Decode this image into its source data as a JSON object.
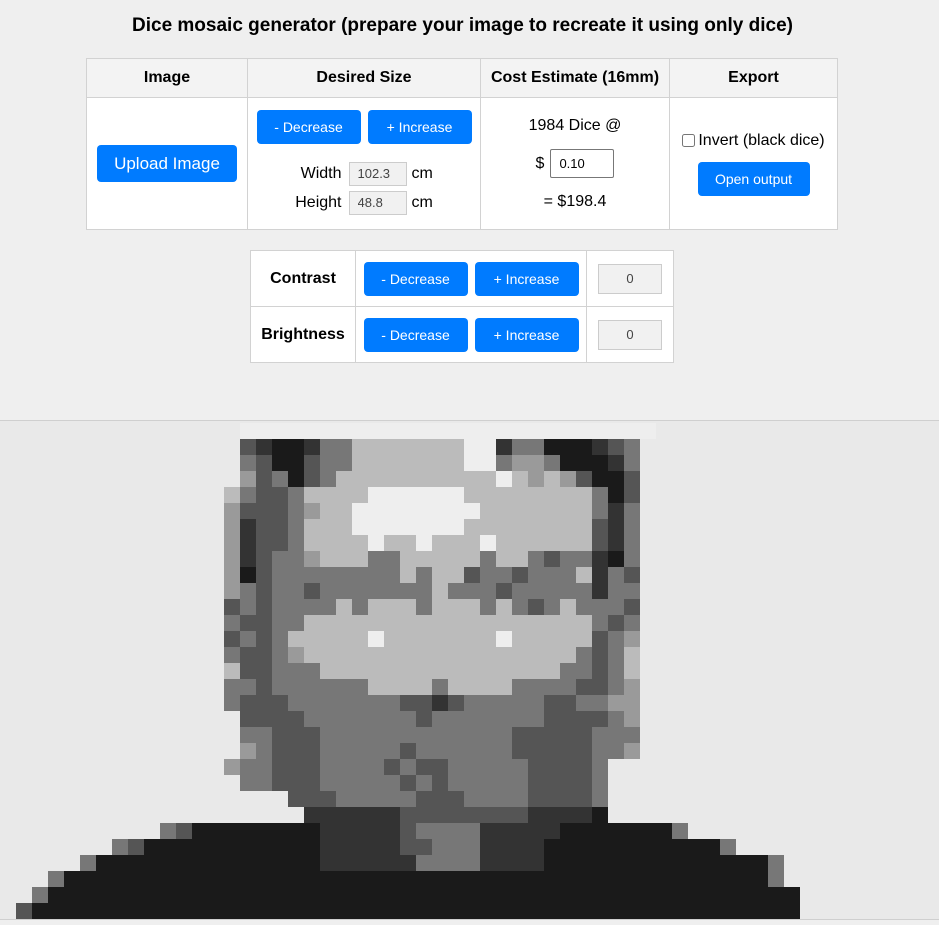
{
  "page": {
    "title": "Dice mosaic generator (prepare your image to recreate it using only dice)"
  },
  "table": {
    "headers": [
      "Image",
      "Desired Size",
      "Cost Estimate (16mm)",
      "Export"
    ]
  },
  "image": {
    "upload_label": "Upload Image"
  },
  "size": {
    "decrease_label": "- Decrease",
    "increase_label": "+ Increase",
    "width_label": "Width",
    "width_value": "102.3",
    "height_label": "Height",
    "height_value": "48.8",
    "unit": "cm"
  },
  "cost": {
    "dice_count_text": "1984 Dice @",
    "currency": "$",
    "price_value": "0.10",
    "total_text": "= $198.4"
  },
  "export": {
    "invert_label": "Invert (black dice)",
    "invert_checked": false,
    "open_output_label": "Open output"
  },
  "adjustments": [
    {
      "label": "Contrast",
      "decrease_label": "- Decrease",
      "increase_label": "+ Increase",
      "value": "0"
    },
    {
      "label": "Brightness",
      "decrease_label": "- Decrease",
      "increase_label": "+ Increase",
      "value": "0"
    }
  ],
  "colors": {
    "accent": "#007bff",
    "page_bg": "#efefef",
    "mosaic_bg": "#e9e9e9",
    "dice_shades": [
      "#eeeeee",
      "#bbbbbb",
      "#9a9a9a",
      "#777777",
      "#555555",
      "#333333",
      "#1a1a1a"
    ]
  },
  "mosaic": {
    "rows": [
      "...............00000000000000000000000000...........................",
      "...............4566533111111100533666543............................",
      "...............3466433111111100322366653............................",
      "...............2436431111111111012124664............................",
      "..............13443111100000011111111364............................",
      "..............24443211000000001111111353............................",
      "..............25443111000000011111111453............................",
      "..............25443111101101110111111453............................",
      "..............25433211133111113113433563............................",
      "..............26433333333131143343331534............................",
      "..............23433433333331333433333533............................",
      "..............43433331311131113134313334............................",
      "..............34433111111111111111111343............................",
      "..............43431111101111111011111432............................",
      "..............34432111111111111111113431............................",
      "..............14433311111111111111133431............................",
      "..............33433333311113111133334432............................",
      "..............34443333333445433333443322............................",
      "...............4444333333343333333444432............................",
      "...............3344433333333333344444333............................",
      "...............2344433333433333344444332............................",
      "..............233444333343443333344443..............................",
      "...............33444333334343333344443..............................",
      "..................44433333444333344443..............................",
      "...................5555554444444455556..............................",
      "..........346666666655555433335555566666663.........................",
      ".......346666666666655555443335555666666666663......................",
      ".....36666666666666655555533335555666666666666663...................",
      "...3666666666666666666666666666666666666666666663...................",
      "..366666666666666666666666666666666666666666666666..................",
      ".4666666666666666666666666666666666666666666666666..................",
      "66666666666666666666666666666666666666666666666666.................."
    ]
  }
}
